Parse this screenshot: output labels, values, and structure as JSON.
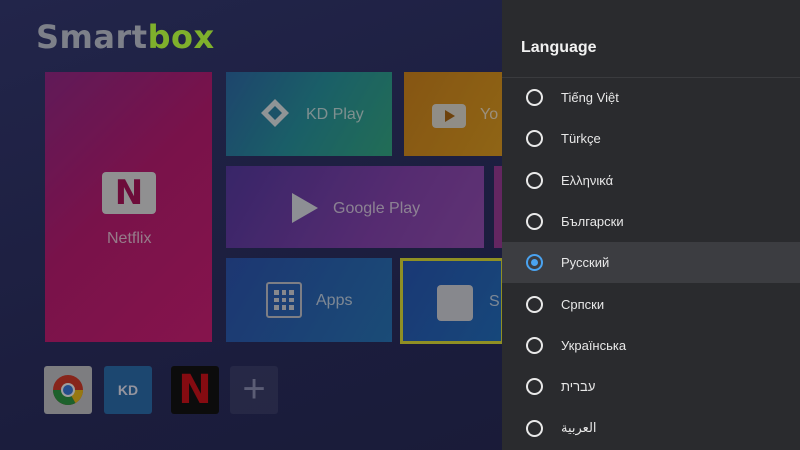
{
  "launcher": {
    "logo": {
      "part1": "Smart",
      "part2": "box"
    },
    "tiles": {
      "netflix": "Netflix",
      "kd_play": "KD Play",
      "youtube": "Yo",
      "google_play": "Google Play",
      "apps": "Apps",
      "settings": "S"
    },
    "favorites": {
      "kd": "KD",
      "netflix": "N",
      "add": "+"
    }
  },
  "language_panel": {
    "title": "Language",
    "selected": "Русский",
    "accent_color": "#4aa3f0",
    "items": [
      {
        "label": "Tiếng Việt"
      },
      {
        "label": "Türkçe"
      },
      {
        "label": "Ελληνικά"
      },
      {
        "label": "Български"
      },
      {
        "label": "Русский"
      },
      {
        "label": "Српски"
      },
      {
        "label": "Українська"
      },
      {
        "label": "עברית"
      },
      {
        "label": "العربية"
      }
    ]
  },
  "icons": [
    "netflix-icon",
    "kodi-icon",
    "youtube-icon",
    "google-play-icon",
    "apps-grid-icon",
    "gear-icon",
    "chrome-icon",
    "radio-icon"
  ]
}
